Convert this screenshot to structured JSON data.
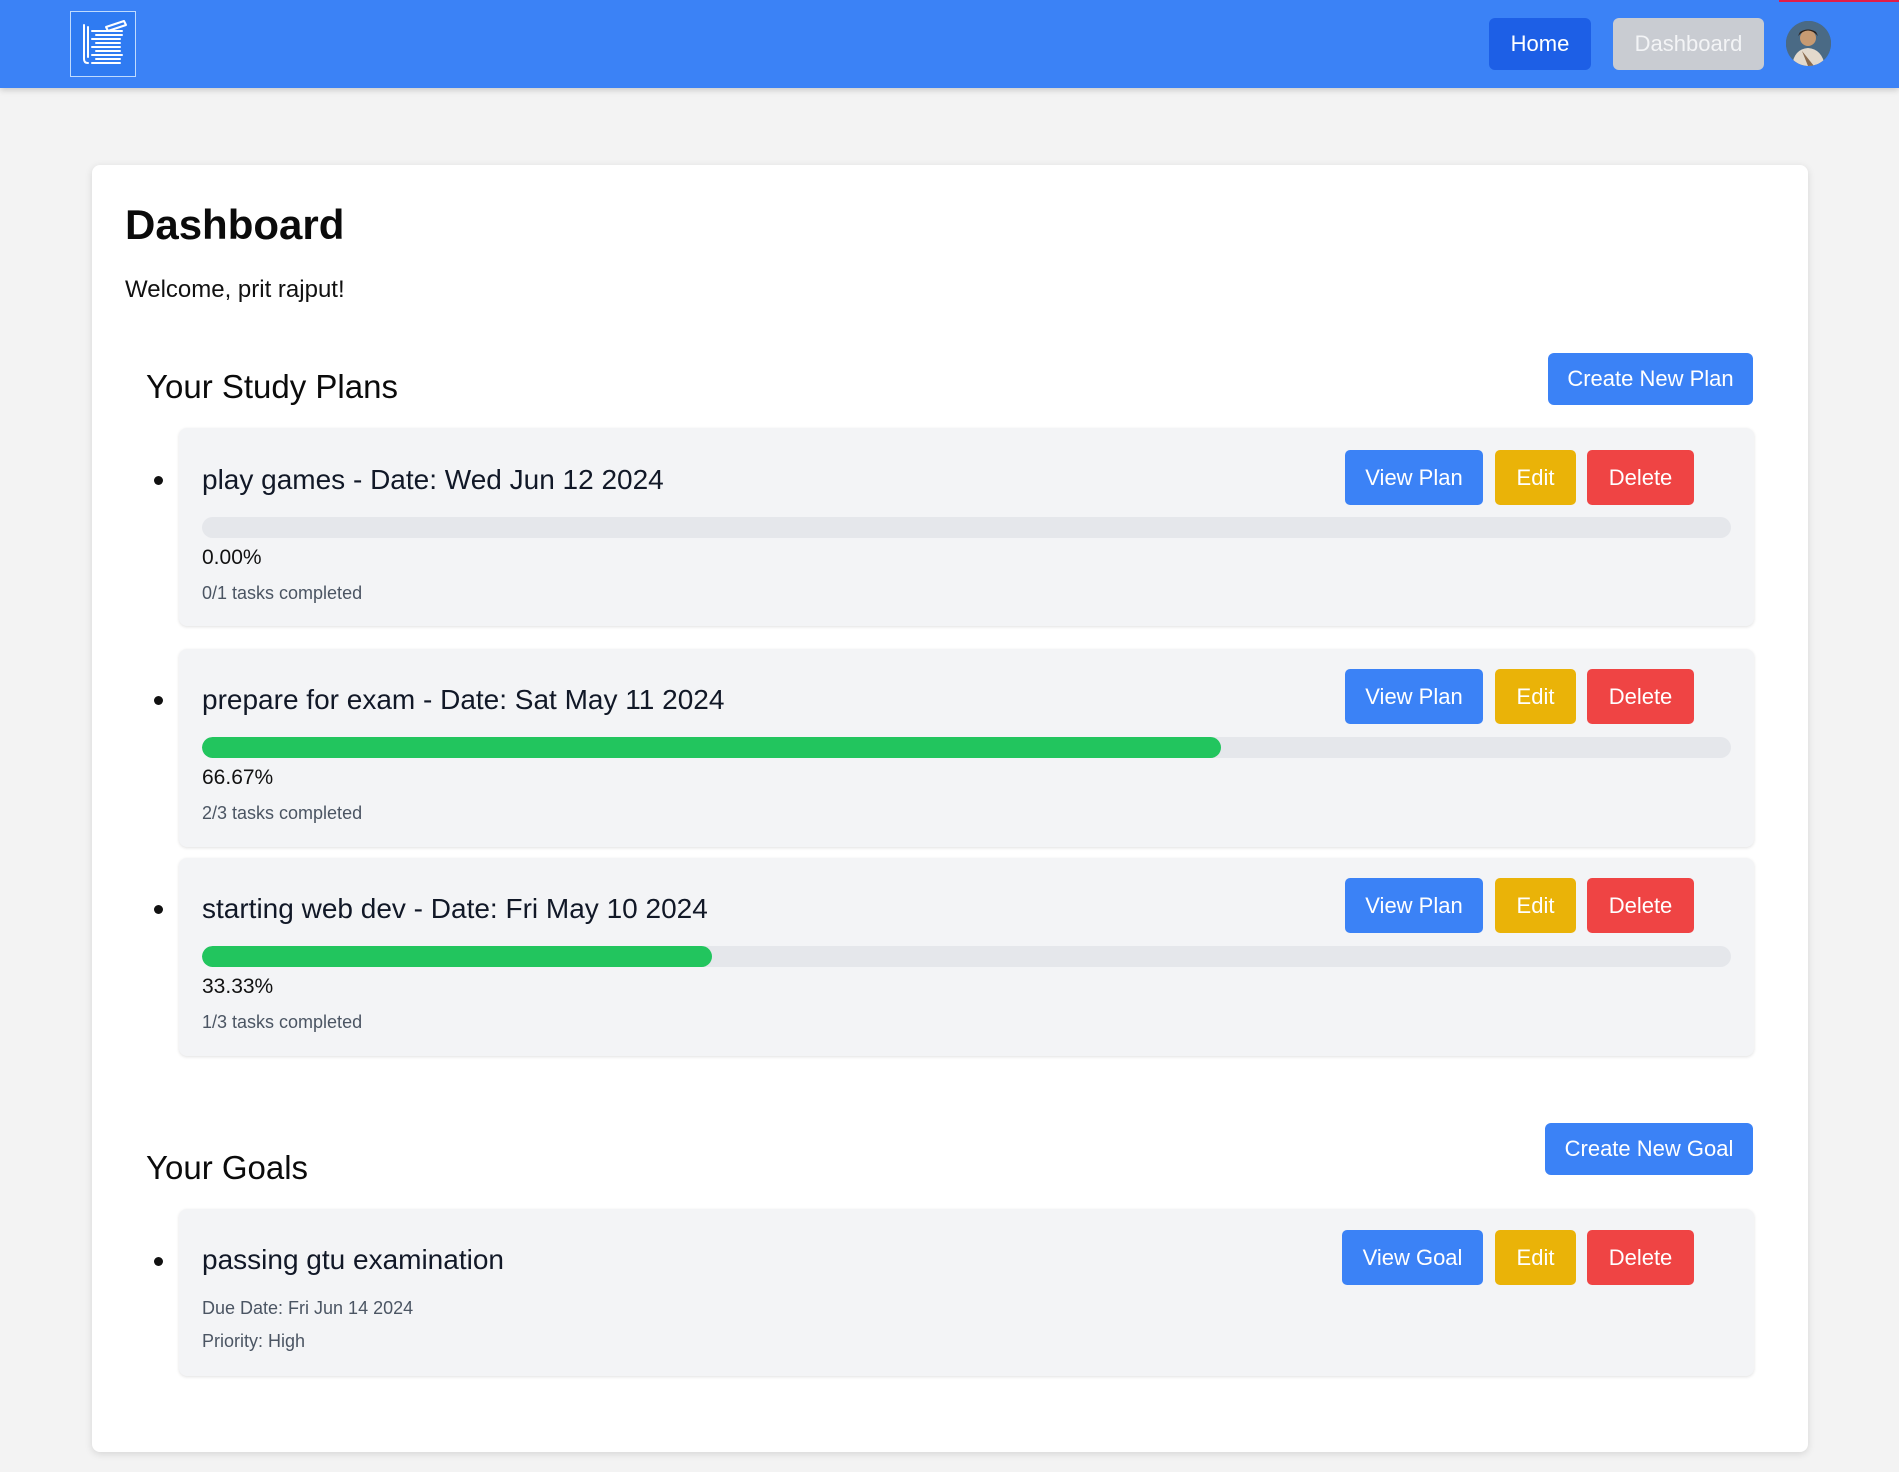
{
  "nav": {
    "home_label": "Home",
    "dashboard_label": "Dashboard",
    "brand_color": "#3b82f6"
  },
  "page": {
    "title": "Dashboard",
    "welcome": "Welcome, prit rajput!"
  },
  "plans": {
    "heading": "Your Study Plans",
    "create_label": "Create New Plan",
    "items": [
      {
        "title": "play games - Date: Wed Jun 12 2024",
        "progress": 0.0,
        "percent_label": "0.00%",
        "tasks_label": "0/1 tasks completed",
        "view_label": "View Plan",
        "edit_label": "Edit",
        "delete_label": "Delete"
      },
      {
        "title": "prepare for exam - Date: Sat May 11 2024",
        "progress": 0.6667,
        "percent_label": "66.67%",
        "tasks_label": "2/3 tasks completed",
        "view_label": "View Plan",
        "edit_label": "Edit",
        "delete_label": "Delete"
      },
      {
        "title": "starting web dev - Date: Fri May 10 2024",
        "progress": 0.3333,
        "percent_label": "33.33%",
        "tasks_label": "1/3 tasks completed",
        "view_label": "View Plan",
        "edit_label": "Edit",
        "delete_label": "Delete"
      }
    ]
  },
  "goals": {
    "heading": "Your Goals",
    "create_label": "Create New Goal",
    "items": [
      {
        "title": "passing gtu examination",
        "due_label": "Due Date: Fri Jun 14 2024",
        "priority_label": "Priority: High",
        "view_label": "View Goal",
        "edit_label": "Edit",
        "delete_label": "Delete"
      }
    ]
  },
  "colors": {
    "view": "#3b82f6",
    "edit": "#eab308",
    "delete": "#ef4444",
    "progress": "#22c55e"
  },
  "icons": {
    "logo": "books-pencil-logo-icon",
    "avatar": "user-avatar"
  }
}
